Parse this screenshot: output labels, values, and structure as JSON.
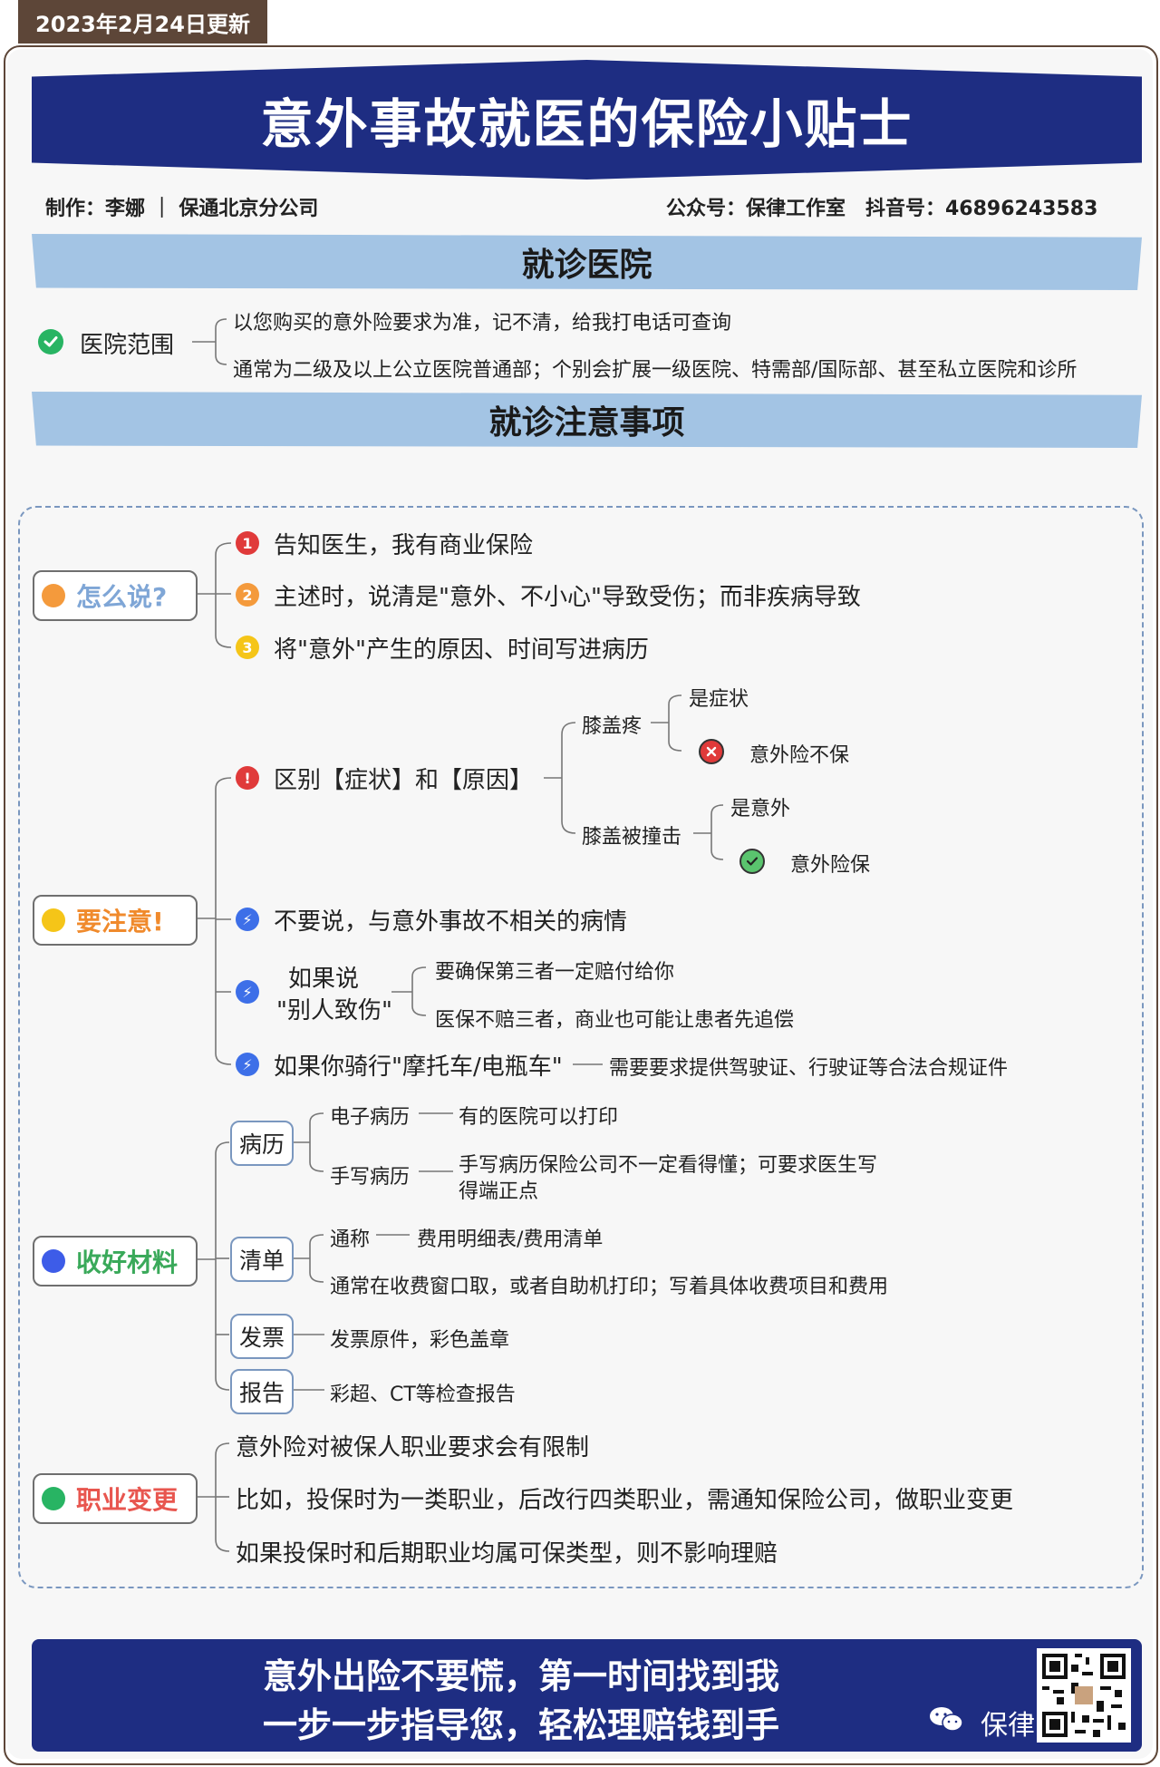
{
  "header": {
    "date": "2023年2月24日更新",
    "title": "意外事故就医的保险小贴士",
    "author": "制作：李娜 ｜ 保通北京分公司",
    "contact": "公众号：保律工作室　抖音号：46896243583"
  },
  "hospital": {
    "section_title": "就诊医院",
    "topic": "医院范围",
    "lines": [
      "以您购买的意外险要求为准，记不清，给我打电话可查询",
      "通常为二级及以上公立医院普通部；个别会扩展一级医院、特需部/国际部、甚至私立医院和诊所"
    ]
  },
  "notes": {
    "section_title": "就诊注意事项",
    "how_to_say": {
      "label": "怎么说?",
      "items": [
        {
          "num": "1",
          "text": "告知医生，我有商业保险"
        },
        {
          "num": "2",
          "text": "主述时，说清是\"意外、不小心\"导致受伤；而非疾病导致"
        },
        {
          "num": "3",
          "text": "将\"意外\"产生的原因、时间写进病历"
        }
      ]
    },
    "attention": {
      "label": "要注意!",
      "distinguish": {
        "text": "区别【症状】和【原因】",
        "case1": {
          "cause": "膝盖疼",
          "judge": "是症状",
          "result": "意外险不保"
        },
        "case2": {
          "cause": "膝盖被撞击",
          "judge": "是意外",
          "result": "意外险保"
        }
      },
      "dont_say": "不要说，与意外事故不相关的病情",
      "others_injury": {
        "label_line1": "如果说",
        "label_line2": "\"别人致伤\"",
        "items": [
          "要确保第三者一定赔付给你",
          "医保不赔三者，商业也可能让患者先追偿"
        ]
      },
      "motorbike": {
        "text": "如果你骑行\"摩托车/电瓶车\"",
        "detail": "需要要求提供驾驶证、行驶证等合法合规证件"
      }
    },
    "materials": {
      "label": "收好材料",
      "records": {
        "label": "病历",
        "electronic": "电子病历",
        "electronic_note": "有的医院可以打印",
        "handwritten": "手写病历",
        "handwritten_note_1": "手写病历保险公司不一定看得懂；可要求医生写",
        "handwritten_note_2": "得端正点"
      },
      "list": {
        "label": "清单",
        "alias": "通称",
        "alias_value": "费用明细表/费用清单",
        "note": "通常在收费窗口取，或者自助机打印；写着具体收费项目和费用"
      },
      "invoice": {
        "label": "发票",
        "note": "发票原件，彩色盖章"
      },
      "report": {
        "label": "报告",
        "note": "彩超、CT等检查报告"
      }
    },
    "job_change": {
      "label": "职业变更",
      "items": [
        "意外险对被保人职业要求会有限制",
        "比如，投保时为一类职业，后改行四类职业，需通知保险公司，做职业变更",
        "如果投保时和后期职业均属可保类型，则不影响理赔"
      ]
    }
  },
  "footer": {
    "line1": "意外出险不要慌，第一时间找到我",
    "line2": "一步一步指导您，轻松理赔钱到手",
    "watermark": "保律"
  },
  "colors": {
    "navy": "#1e2d82",
    "section_blue": "#a3c4e4",
    "orange": "#f49a3c",
    "yellow": "#f5c518",
    "blue_dot": "#3d5ce8",
    "green_dot": "#28b463",
    "red_icon": "#e03a3a",
    "lightning_blue": "#3d6fe8"
  }
}
